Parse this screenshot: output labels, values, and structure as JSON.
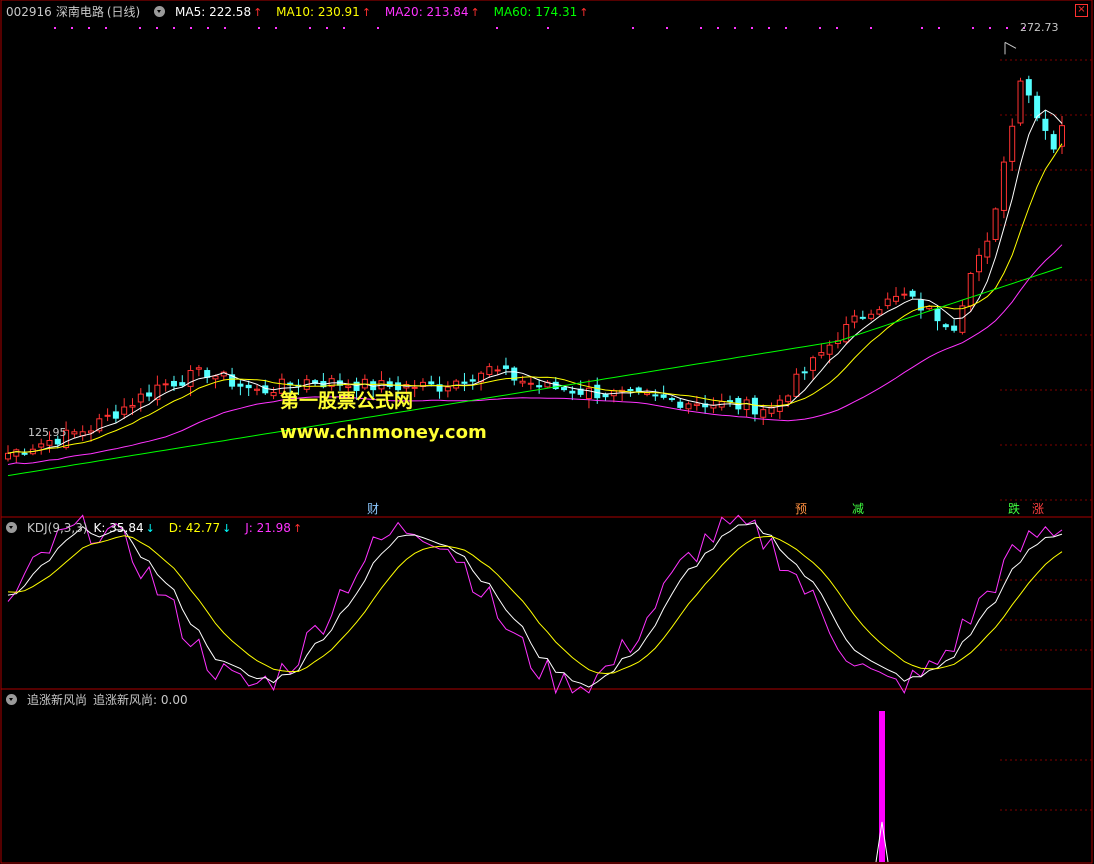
{
  "main_panel": {
    "stock_code": "002916",
    "stock_name": "深南电路",
    "period": "(日线)",
    "ma5": {
      "label": "MA5: 222.58",
      "arrow": "↑",
      "color": "#ffffff"
    },
    "ma10": {
      "label": "MA10: 230.91",
      "arrow": "↑",
      "color": "#ffff00"
    },
    "ma20": {
      "label": "MA20: 213.84",
      "arrow": "↑",
      "color": "#ff33ff"
    },
    "ma60": {
      "label": "MA60: 174.31",
      "arrow": "↑",
      "color": "#00ff00"
    },
    "high_price_label": "272.73",
    "low_price_label": "125.95",
    "events": [
      {
        "text": "财",
        "color": "#8cc8ff"
      },
      {
        "text": "预",
        "color": "#ff9040"
      },
      {
        "text": "减",
        "color": "#40ff40"
      },
      {
        "text": "跌",
        "color": "#40ff40"
      },
      {
        "text": "涨",
        "color": "#ff4040"
      }
    ],
    "watermark_title": "第一股票公式网",
    "watermark_url": "www.chnmoney.com"
  },
  "kdj_panel": {
    "title": "KDJ(9,3,3)",
    "k": {
      "label": "K: 35.84",
      "arrow": "↓",
      "color": "#ffffff"
    },
    "d": {
      "label": "D: 42.77",
      "arrow": "↓",
      "color": "#ffff00"
    },
    "j": {
      "label": "J: 21.98",
      "arrow": "↑",
      "color": "#ff33ff"
    }
  },
  "indicator_panel": {
    "title": "追涨新风尚",
    "value_label": "追涨新风尚: 0.00"
  },
  "colors": {
    "up": "#ff3232",
    "down": "#54ffff",
    "grid": "#800000",
    "border": "#aa0000"
  },
  "chart_data": {
    "type": "candlestick",
    "price_axis_range": [
      110,
      280
    ],
    "price_high": 272.73,
    "price_low": 125.95,
    "ma_series": [
      {
        "name": "MA5",
        "color": "#ffffff"
      },
      {
        "name": "MA10",
        "color": "#ffff00"
      },
      {
        "name": "MA20",
        "color": "#ff33ff"
      },
      {
        "name": "MA60",
        "color": "#00ff00"
      }
    ],
    "kdj_range": [
      0,
      100
    ],
    "indicator_spike_value": 1
  }
}
